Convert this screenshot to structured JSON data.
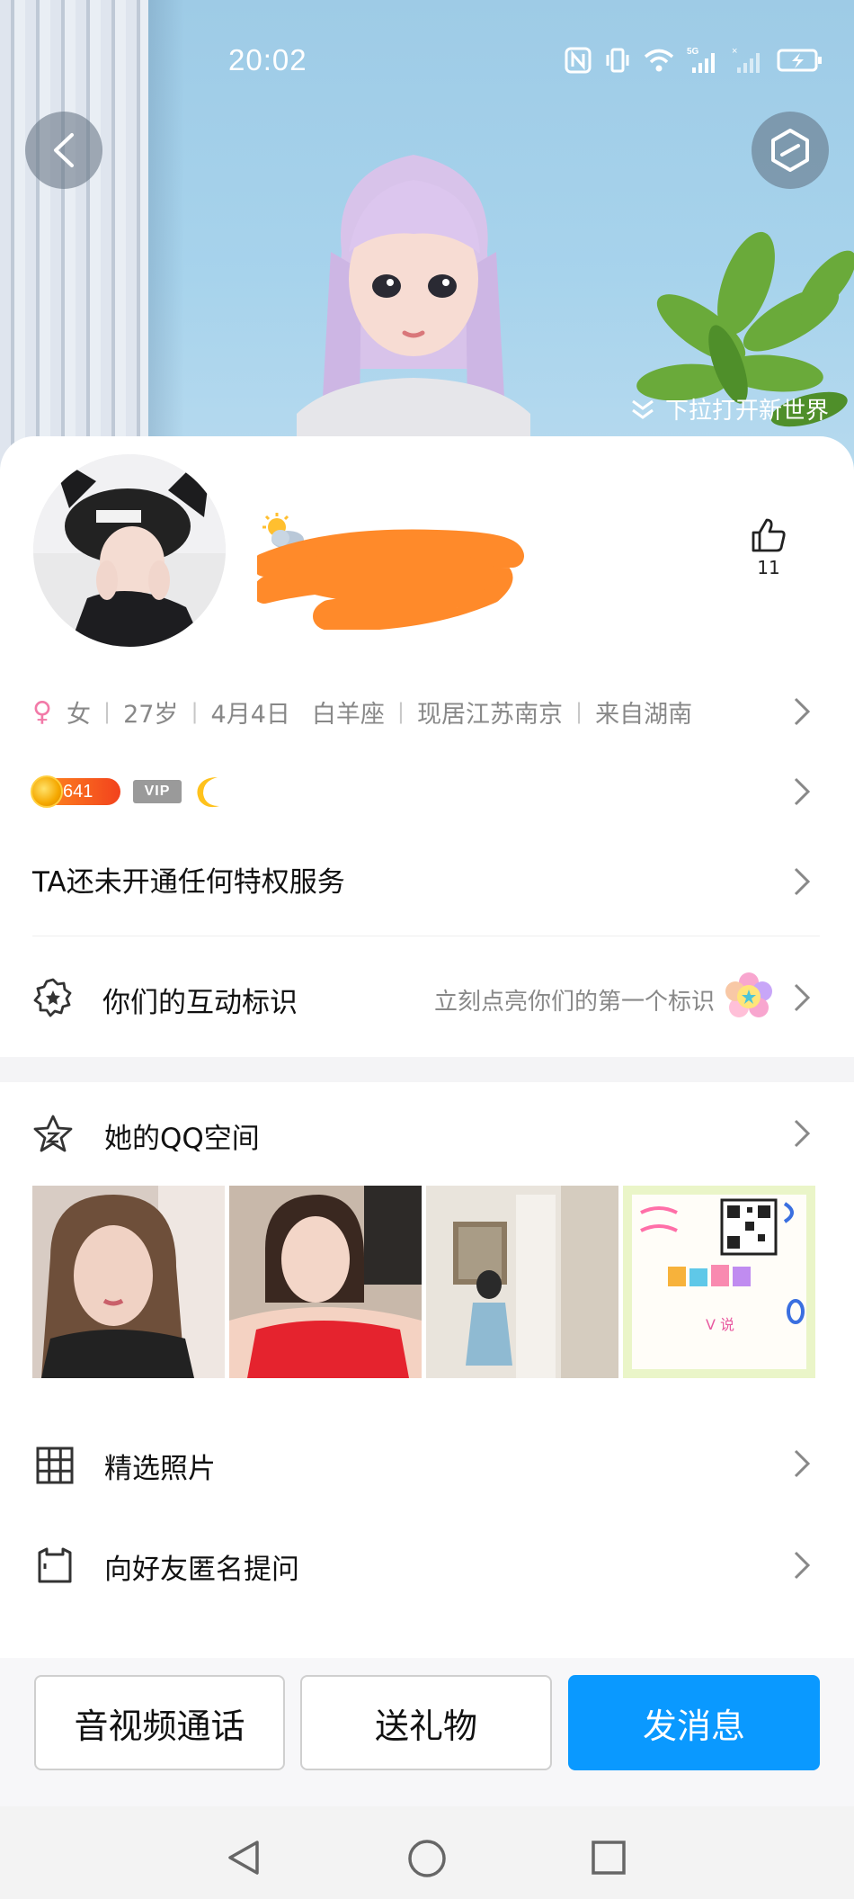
{
  "status_bar": {
    "time": "20:02"
  },
  "hero": {
    "pull_hint": "下拉打开新世界"
  },
  "profile": {
    "likes": "11",
    "gender_symbol": "♀",
    "info": {
      "gender": "女",
      "age": "27岁",
      "birthday": "4月4日",
      "zodiac": "白羊座",
      "location": "现居江苏南京",
      "hometown": "来自湖南"
    },
    "level": "641",
    "vip_label": "VIP",
    "privilege_text": "TA还未开通任何特权服务",
    "interaction_title": "你们的互动标识",
    "interaction_hint": "立刻点亮你们的第一个标识"
  },
  "qzone": {
    "title": "她的QQ空间",
    "photo4_text": "V 说"
  },
  "menu": {
    "featured_photos": "精选照片",
    "anonymous_question": "向好友匿名提问"
  },
  "actions": {
    "call": "音视频通话",
    "gift": "送礼物",
    "message": "发消息"
  },
  "colors": {
    "accent": "#0a99ff",
    "level_gradient": "#f2421d",
    "gender_pink": "#f27aa8"
  },
  "icons": [
    "back-icon",
    "world-icon",
    "thumb-up-icon",
    "chevron-right-icon",
    "badge-star-icon",
    "star-icon",
    "grid-icon",
    "question-box-icon"
  ]
}
